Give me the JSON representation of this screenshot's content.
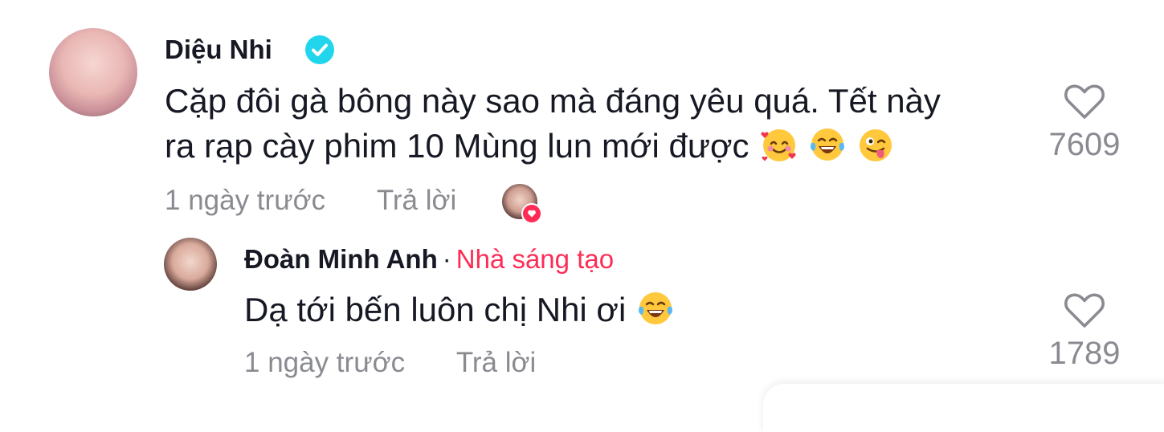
{
  "comments": [
    {
      "author": "Diệu Nhi",
      "verified": true,
      "text_line1": "Cặp đôi gà bông này sao mà đáng yêu quá. Tết này",
      "text_line2": "ra rạp cày phim 10 Mùng lun mới được",
      "emojis": [
        "smiling-face-with-hearts",
        "tears-of-joy",
        "winking-face-with-tongue"
      ],
      "time": "1 ngày trước",
      "reply_label": "Trả lời",
      "likes": "7609",
      "creator_liked": true
    },
    {
      "author": "Đoàn Minh Anh",
      "separator": "·",
      "badge": "Nhà sáng tạo",
      "text": "Dạ tới bến luôn chị Nhi ơi",
      "emojis": [
        "tears-of-joy"
      ],
      "time": "1 ngày trước",
      "reply_label": "Trả lời",
      "likes": "1789"
    }
  ],
  "colors": {
    "accent": "#fe2c55",
    "verified": "#20d5ec",
    "muted": "#8a8b91",
    "text": "#161823"
  }
}
